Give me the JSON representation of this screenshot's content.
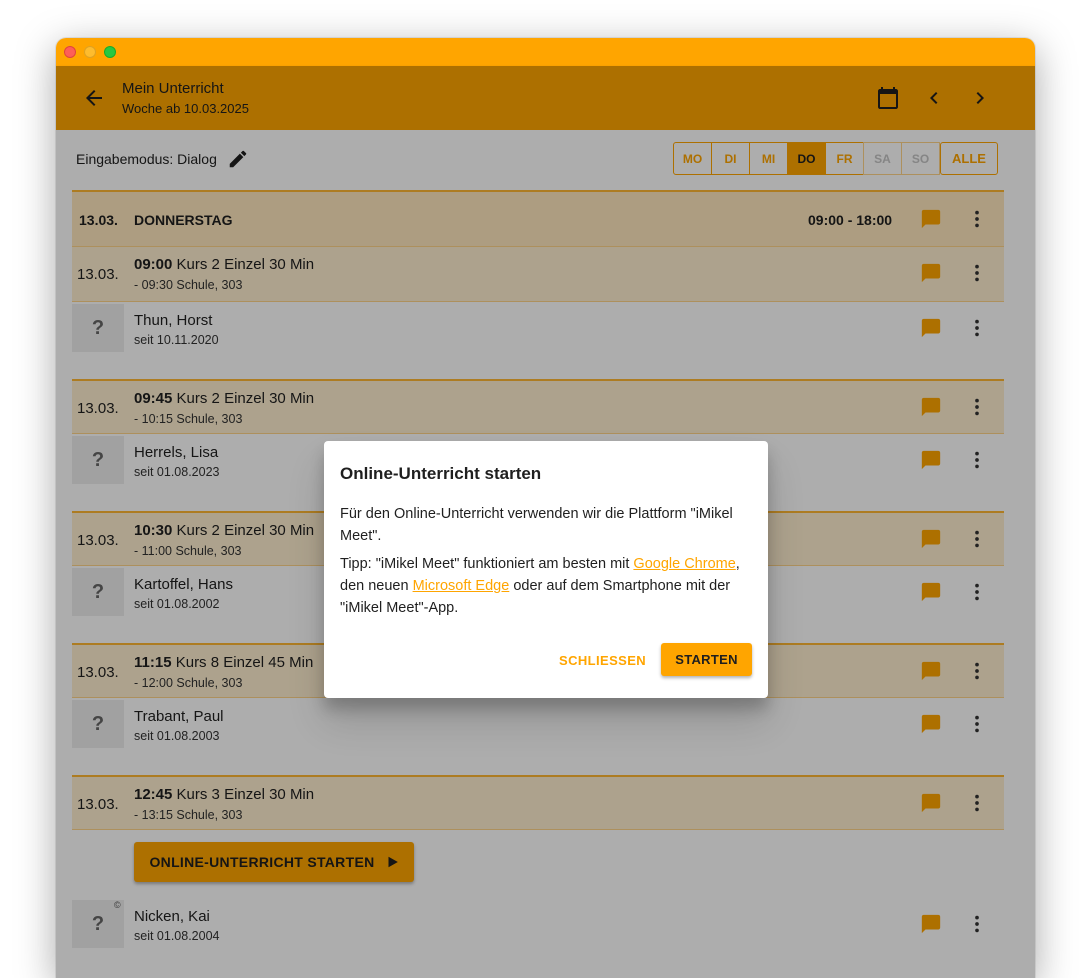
{
  "appbar": {
    "title": "Mein Unterricht",
    "subtitle": "Woche ab 10.03.2025",
    "icons": [
      "arrow-back-icon",
      "calendar-icon",
      "chevron-left-icon",
      "chevron-right-icon"
    ]
  },
  "mode": {
    "label": "Eingabemodus: Dialog",
    "icon": "pencil-icon"
  },
  "days": [
    "MO",
    "DI",
    "MI",
    "DO",
    "FR",
    "SA",
    "SO"
  ],
  "days_active": "DO",
  "days_all": "ALLE",
  "dayhead": {
    "date": "13.03.",
    "name": "DONNERSTAG",
    "time": "09:00 - 18:00"
  },
  "lessons": [
    {
      "date": "13.03.",
      "time": "09:00",
      "title": "Kurs 2 Einzel 30 Min",
      "sub": "- 09:30 Schule, 303",
      "student": "Thun, Horst",
      "since": "seit 10.11.2020"
    },
    {
      "date": "13.03.",
      "time": "09:45",
      "title": "Kurs 2 Einzel 30 Min",
      "sub": "- 10:15 Schule, 303",
      "student": "Herrels, Lisa",
      "since": "seit 01.08.2023"
    },
    {
      "date": "13.03.",
      "time": "10:30",
      "title": "Kurs 2 Einzel 30 Min",
      "sub": "- 11:00 Schule, 303",
      "student": "Kartoffel, Hans",
      "since": "seit 01.08.2002"
    },
    {
      "date": "13.03.",
      "time": "11:15",
      "title": "Kurs 8 Einzel 45 Min",
      "sub": "- 12:00 Schule, 303",
      "student": "Trabant, Paul",
      "since": "seit 01.08.2003"
    },
    {
      "date": "13.03.",
      "time": "12:45",
      "title": "Kurs 3 Einzel 30 Min",
      "sub": "- 13:15 Schule, 303",
      "student": "Nicken, Kai",
      "since": "seit 01.08.2004"
    }
  ],
  "avatar_placeholder": "?",
  "copyright_mark": "©",
  "start_button": "ONLINE-UNTERRICHT STARTEN",
  "dialog": {
    "title": "Online-Unterricht starten",
    "p1": "Für den Online-Unterricht verwenden wir die Plattform \"iMikel Meet\".",
    "p2_a": "Tipp: \"iMikel Meet\" funktioniert am besten mit ",
    "link1": "Google Chrome",
    "p2_b": ", den neuen ",
    "link2": "Microsoft Edge",
    "p2_c": " oder auf dem Smartphone mit der \"iMikel Meet\"-App.",
    "close": "SCHLIESSEN",
    "ok": "STARTEN"
  },
  "colors": {
    "accent": "#ffa500",
    "row_bg": "#ffefd0"
  }
}
